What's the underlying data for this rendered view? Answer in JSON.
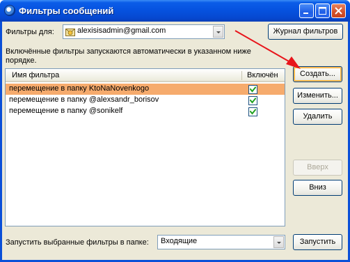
{
  "window": {
    "title": "Фильтры сообщений"
  },
  "account": {
    "label": "Фильтры для:",
    "selected": "alexisisadmin@gmail.com"
  },
  "buttons": {
    "log": "Журнал фильтров",
    "create": "Создать...",
    "edit": "Изменить...",
    "delete": "Удалить",
    "up": "Вверх",
    "down": "Вниз",
    "run": "Запустить"
  },
  "description": "Включённые фильтры запускаются автоматически в указанном ниже порядке.",
  "list": {
    "columns": {
      "name": "Имя фильтра",
      "enabled": "Включён"
    },
    "rows": [
      {
        "name": "перемещение в папку KtoNaNovenkogo",
        "enabled": true,
        "selected": true
      },
      {
        "name": "перемещение в папку @alexsandr_borisov",
        "enabled": true,
        "selected": false
      },
      {
        "name": "перемещение в папку @sonikelf",
        "enabled": true,
        "selected": false
      }
    ]
  },
  "run": {
    "label": "Запустить выбранные фильтры в папке:",
    "folder": "Входящие"
  },
  "colors": {
    "selection": "#f6ab6d",
    "annotation_arrow": "#e8151b"
  }
}
